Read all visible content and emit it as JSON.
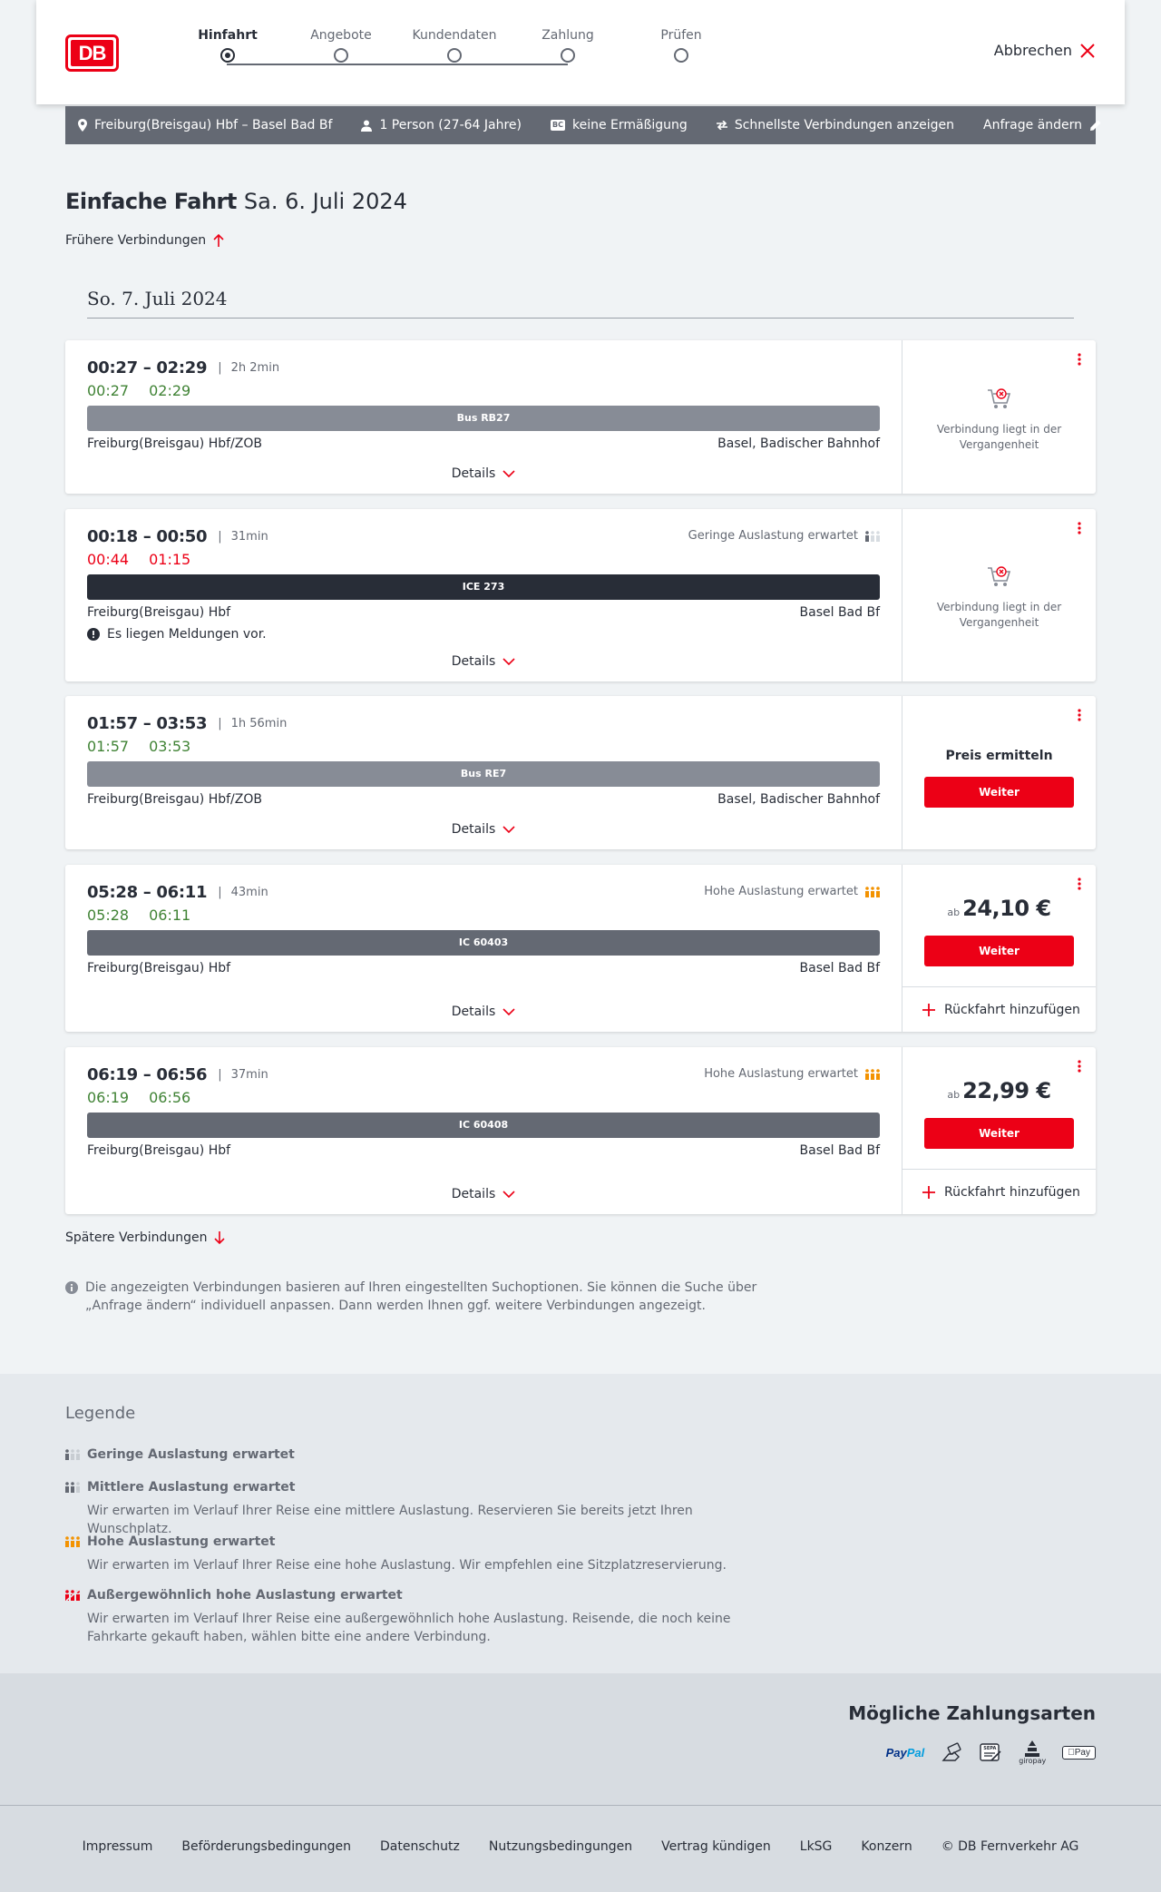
{
  "brand": {
    "logo_text": "DB",
    "color": "#ec0016"
  },
  "header": {
    "steps": [
      {
        "label": "Hinfahrt",
        "active": true
      },
      {
        "label": "Angebote",
        "active": false
      },
      {
        "label": "Kundendaten",
        "active": false
      },
      {
        "label": "Zahlung",
        "active": false
      },
      {
        "label": "Prüfen",
        "active": false
      }
    ],
    "cancel_label": "Abbrechen"
  },
  "summary": {
    "route": "Freiburg(Breisgau) Hbf – Basel Bad Bf",
    "travelers": "1 Person (27-64 Jahre)",
    "discount_badge": "BC",
    "discount": "keine Ermäßigung",
    "option": "Schnellste Verbindungen anzeigen",
    "change_label": "Anfrage ändern"
  },
  "page": {
    "title_bold": "Einfache Fahrt",
    "title_date": "Sa. 6. Juli 2024",
    "earlier_label": "Frühere Verbindungen",
    "day_header": "So. 7. Juli 2024",
    "later_label": "Spätere Verbindungen",
    "info_note": "Die angezeigten Verbindungen basieren auf Ihren eingestellten Suchoptionen. Sie können die Suche über „Anfrage ändern“ individuell anpassen. Dann werden Ihnen ggf. weitere Verbindungen angezeigt."
  },
  "connections": [
    {
      "planned": "00:27 – 02:29",
      "duration": "2h 2min",
      "rt_dep": "00:27",
      "rt_arr": "02:29",
      "train": "Bus RB27",
      "from": "Freiburg(Breisgau) Hbf/ZOB",
      "to": "Basel, Badischer Bahnhof",
      "details_label": "Details",
      "past_text": "Verbindung liegt in der Vergangenheit"
    },
    {
      "planned": "00:18 – 00:50",
      "duration": "31min",
      "rt_dep": "00:44",
      "rt_arr": "01:15",
      "occupancy": "Geringe Auslastung erwartet",
      "train": "ICE 273",
      "from": "Freiburg(Breisgau) Hbf",
      "to": "Basel Bad Bf",
      "message": "Es liegen Meldungen vor.",
      "details_label": "Details",
      "past_text": "Verbindung liegt in der Vergangenheit"
    },
    {
      "planned": "01:57 – 03:53",
      "duration": "1h 56min",
      "rt_dep": "01:57",
      "rt_arr": "03:53",
      "train": "Bus RE7",
      "from": "Freiburg(Breisgau) Hbf/ZOB",
      "to": "Basel, Badischer Bahnhof",
      "details_label": "Details",
      "price_label": "Preis ermitteln",
      "button_label": "Weiter"
    },
    {
      "planned": "05:28 – 06:11",
      "duration": "43min",
      "rt_dep": "05:28",
      "rt_arr": "06:11",
      "occupancy": "Hohe Auslastung erwartet",
      "train": "IC 60403",
      "from": "Freiburg(Breisgau) Hbf",
      "to": "Basel Bad Bf",
      "details_label": "Details",
      "price_prefix": "ab",
      "price": "24,10 €",
      "button_label": "Weiter",
      "return_label": "Rückfahrt hinzufügen"
    },
    {
      "planned": "06:19 – 06:56",
      "duration": "37min",
      "rt_dep": "06:19",
      "rt_arr": "06:56",
      "occupancy": "Hohe Auslastung erwartet",
      "train": "IC 60408",
      "from": "Freiburg(Breisgau) Hbf",
      "to": "Basel Bad Bf",
      "details_label": "Details",
      "price_prefix": "ab",
      "price": "22,99 €",
      "button_label": "Weiter",
      "return_label": "Rückfahrt hinzufügen"
    }
  ],
  "legend": {
    "title": "Legende",
    "items": [
      {
        "title": "Geringe Auslastung erwartet",
        "desc": ""
      },
      {
        "title": "Mittlere Auslastung erwartet",
        "desc": "Wir erwarten im Verlauf Ihrer Reise eine mittlere Auslastung. Reservieren Sie bereits jetzt Ihren Wunschplatz."
      },
      {
        "title": "Hohe Auslastung erwartet",
        "desc": "Wir erwarten im Verlauf Ihrer Reise eine hohe Auslastung. Wir empfehlen eine Sitzplatzreservierung."
      },
      {
        "title": "Außergewöhnlich hohe Auslastung erwartet",
        "desc": "Wir erwarten im Verlauf Ihrer Reise eine außergewöhnlich hohe Auslastung. Reisende, die noch keine Fahrkarte gekauft haben, wählen bitte eine andere Verbindung."
      }
    ]
  },
  "payment": {
    "title": "Mögliche Zahlungsarten",
    "paypal_a": "Pay",
    "paypal_b": "Pal",
    "sepa": "SEPA",
    "giropay": "giropay",
    "apple_pay": "Pay"
  },
  "footer": {
    "links": [
      "Impressum",
      "Beförderungsbedingungen",
      "Datenschutz",
      "Nutzungsbedingungen",
      "Vertrag kündigen",
      "LkSG",
      "Konzern",
      "© DB Fernverkehr AG"
    ]
  },
  "colors": {
    "ontime": "#408335",
    "late": "#ec0016",
    "occupancy_high": "#f39200"
  }
}
